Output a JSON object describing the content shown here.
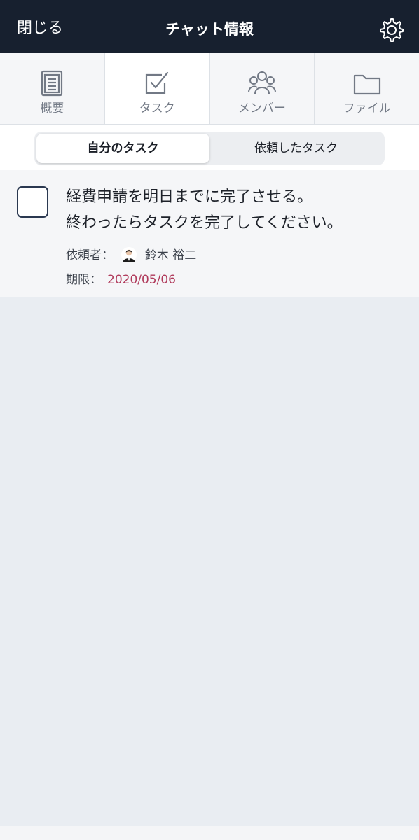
{
  "header": {
    "close_label": "閉じる",
    "title": "チャット情報",
    "settings_icon": "gear-icon"
  },
  "tabs": [
    {
      "label": "概要",
      "icon": "clipboard-icon",
      "active": false
    },
    {
      "label": "タスク",
      "icon": "checkbox-icon",
      "active": true
    },
    {
      "label": "メンバー",
      "icon": "people-icon",
      "active": false
    },
    {
      "label": "ファイル",
      "icon": "folder-icon",
      "active": false
    }
  ],
  "segment": {
    "my_tasks": "自分のタスク",
    "requested_tasks": "依頼したタスク",
    "selected": "my_tasks"
  },
  "task": {
    "line1": "経費申請を明日までに完了させる。",
    "line2": "終わったらタスクを完了してください。",
    "requester_label": "依頼者：",
    "requester_name": "鈴木 裕二",
    "deadline_label": "期限：",
    "deadline": "2020/05/06",
    "completed": false
  },
  "colors": {
    "header_bg": "#17202f",
    "deadline": "#b03a5b",
    "list_bg": "#e9edf2"
  }
}
